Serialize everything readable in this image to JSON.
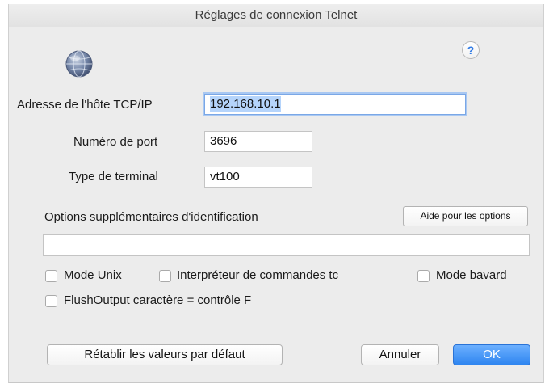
{
  "window": {
    "title": "Réglages de connexion Telnet"
  },
  "help": {
    "label": "?"
  },
  "icons": {
    "app": "globe-icon",
    "help": "help-icon"
  },
  "fields": {
    "host": {
      "label": "Adresse de l'hôte TCP/IP",
      "value": "192.168.10.1"
    },
    "port": {
      "label": "Numéro de port",
      "value": "3696"
    },
    "terminal": {
      "label": "Type de terminal",
      "value": "vt100"
    }
  },
  "options": {
    "label": "Options supplémentaires d'identification",
    "help_button": "Aide pour les options",
    "value": ""
  },
  "checkboxes": {
    "unix": {
      "label": "Mode Unix",
      "checked": false
    },
    "tc": {
      "label": "Interpréteur de commandes tc",
      "checked": false
    },
    "verbose": {
      "label": "Mode bavard",
      "checked": false
    },
    "flush": {
      "label": "FlushOutput caractère = contrôle F",
      "checked": false
    }
  },
  "buttons": {
    "reset": "Rétablir les valeurs par défaut",
    "cancel": "Annuler",
    "ok": "OK"
  },
  "colors": {
    "accent": "#2e85f0",
    "focus": "#a9c8f2",
    "window_bg": "#ececec"
  }
}
